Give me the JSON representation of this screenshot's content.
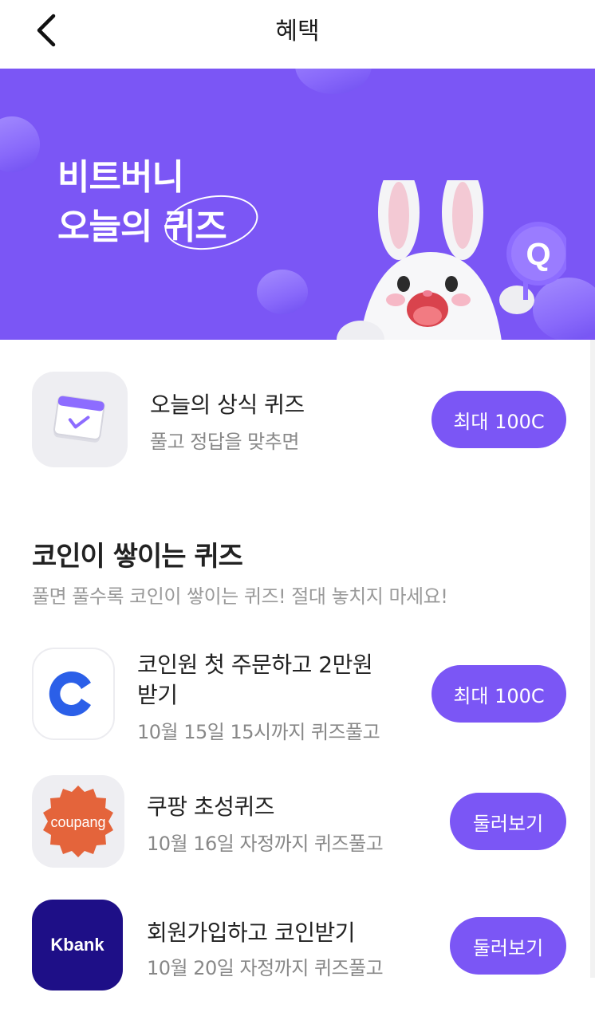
{
  "header": {
    "title": "혜택",
    "back_icon": "chevron-left-icon"
  },
  "banner": {
    "title_line1": "비트버니",
    "title_line2_prefix": "오늘의 ",
    "title_line2_highlight": "퀴즈",
    "mascot": "bunny-mascot",
    "badge_letter": "Q",
    "background": "#7b56f5"
  },
  "daily_quiz": {
    "title": "오늘의 상식 퀴즈",
    "subtitle": "풀고 정답을 맞추면",
    "button_label": "최대 100C",
    "icon": "calendar-check-icon"
  },
  "section": {
    "title": "코인이 쌓이는 퀴즈",
    "subtitle": "풀면 풀수록 코인이 쌓이는 퀴즈! 절대 놓치지 마세요!"
  },
  "quizzes": [
    {
      "title_line1": "코인원 첫 주문하고 2만원",
      "title_line2": "받기",
      "subtitle": "10월 15일 15시까지 퀴즈풀고",
      "button_label": "최대 100C",
      "brand": "coinone-logo"
    },
    {
      "title": "쿠팡 초성퀴즈",
      "subtitle": "10월 16일 자정까지 퀴즈풀고",
      "button_label": "둘러보기",
      "brand_text": "coupang"
    },
    {
      "title": "회원가입하고 코인받기",
      "subtitle": "10월 20일 자정까지 퀴즈풀고",
      "button_label": "둘러보기",
      "brand_text": "Kbank"
    }
  ],
  "colors": {
    "accent": "#7b56f5",
    "coinone": "#2b5fe8",
    "coupang": "#e4643b",
    "kbank": "#1e0f87"
  }
}
